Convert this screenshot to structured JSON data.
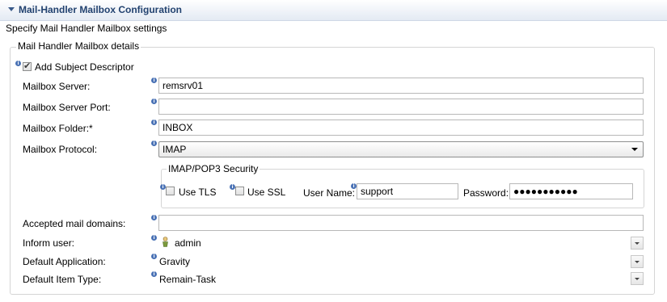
{
  "header": {
    "title": "Mail-Handler Mailbox Configuration"
  },
  "subtitle": "Specify Mail Handler Mailbox settings",
  "group_title": "Mail Handler Mailbox details",
  "add_subject_descriptor": {
    "label": "Add Subject Descriptor",
    "checked": true
  },
  "fields": {
    "mailbox_server": {
      "label": "Mailbox Server:",
      "value": "remsrv01"
    },
    "mailbox_server_port": {
      "label": "Mailbox Server Port:",
      "value": ""
    },
    "mailbox_folder": {
      "label": "Mailbox Folder:*",
      "value": "INBOX"
    },
    "mailbox_protocol": {
      "label": "Mailbox Protocol:",
      "value": "IMAP"
    },
    "accepted_mail_domains": {
      "label": "Accepted mail domains:",
      "value": ""
    },
    "inform_user": {
      "label": "Inform user:",
      "value": "admin"
    },
    "default_application": {
      "label": "Default Application:",
      "value": "Gravity"
    },
    "default_item_type": {
      "label": "Default Item Type:",
      "value": "Remain-Task"
    }
  },
  "security": {
    "title": "IMAP/POP3 Security",
    "use_tls": {
      "label": "Use TLS",
      "checked": false
    },
    "use_ssl": {
      "label": "Use SSL",
      "checked": false
    },
    "user_name": {
      "label": "User Name:",
      "value": "support"
    },
    "password": {
      "label": "Password:",
      "value": "●●●●●●●●●●●"
    }
  },
  "icons": {
    "info": "info-icon",
    "user": "user-icon",
    "dropdown": "chevron-down-icon"
  },
  "colors": {
    "header_text": "#22426f",
    "info_icon": "#4a72b5"
  }
}
